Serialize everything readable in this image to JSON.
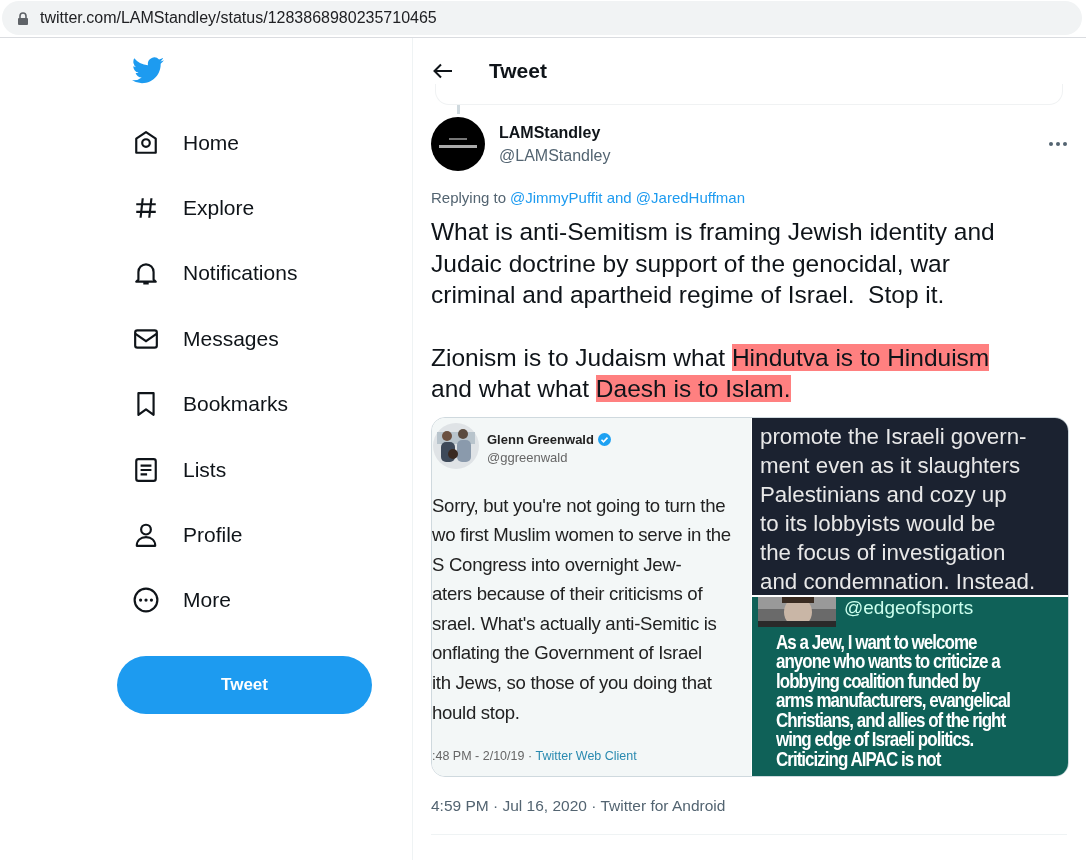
{
  "browser": {
    "url": "twitter.com/LAMStandley/status/1283868980235710465"
  },
  "sidebar": {
    "items": [
      {
        "label": "Home"
      },
      {
        "label": "Explore"
      },
      {
        "label": "Notifications"
      },
      {
        "label": "Messages"
      },
      {
        "label": "Bookmarks"
      },
      {
        "label": "Lists"
      },
      {
        "label": "Profile"
      },
      {
        "label": "More"
      }
    ],
    "tweet_button": "Tweet"
  },
  "header": {
    "title": "Tweet"
  },
  "tweet": {
    "name": "LAMStandley",
    "handle": "@LAMStandley",
    "reply_prefix": "Replying to",
    "reply_to": "@JimmyPuffit and @JaredHuffman",
    "paragraphs": [
      [
        {
          "text": "What is anti-Semitism is framing Jewish identity and Judaic doctrine by support of the genocidal, war criminal and apartheid regime of Israel.  Stop it.",
          "highlighted": false
        }
      ],
      [
        {
          "text": "Zionism is to Judaism what ",
          "highlighted": false
        },
        {
          "text": "Hindutva is to Hinduism",
          "highlighted": true
        },
        {
          "text": " and what what ",
          "highlighted": false
        },
        {
          "text": "Daesh is to Islam.",
          "highlighted": true
        }
      ]
    ],
    "media": {
      "left": {
        "author": "Glenn Greenwald",
        "handle": "@ggreenwald",
        "lines": [
          "Sorry, but you're not going to turn the",
          "wo first Muslim women to serve in the",
          "S Congress into overnight Jew-",
          "aters because of their criticisms of",
          "srael. What's actually anti-Semitic is",
          "onflating the Government of Israel",
          "ith Jews, so those of you doing that",
          "hould stop."
        ],
        "time": ":48 PM - 2/10/19 · ",
        "client": "Twitter Web Client"
      },
      "top_right": {
        "lines": [
          "promote the Israeli govern-",
          "ment even as it slaughters",
          "Palestinians and cozy up",
          "to its lobbyists would be",
          "the focus of investigation",
          "and condemnation. Instead."
        ]
      },
      "bottom_right": {
        "handle": "@edgeofsports",
        "lines": [
          "As a Jew, I want to welcome",
          "anyone who wants to criticize a",
          "lobbying coalition funded by",
          "arms manufacturers, evangelical",
          "Christians, and allies of the right",
          "wing edge of Israeli politics.",
          "Criticizing AIPAC is not"
        ]
      }
    },
    "meta": "4:59 PM · Jul 16, 2020 · Twitter for Android"
  }
}
